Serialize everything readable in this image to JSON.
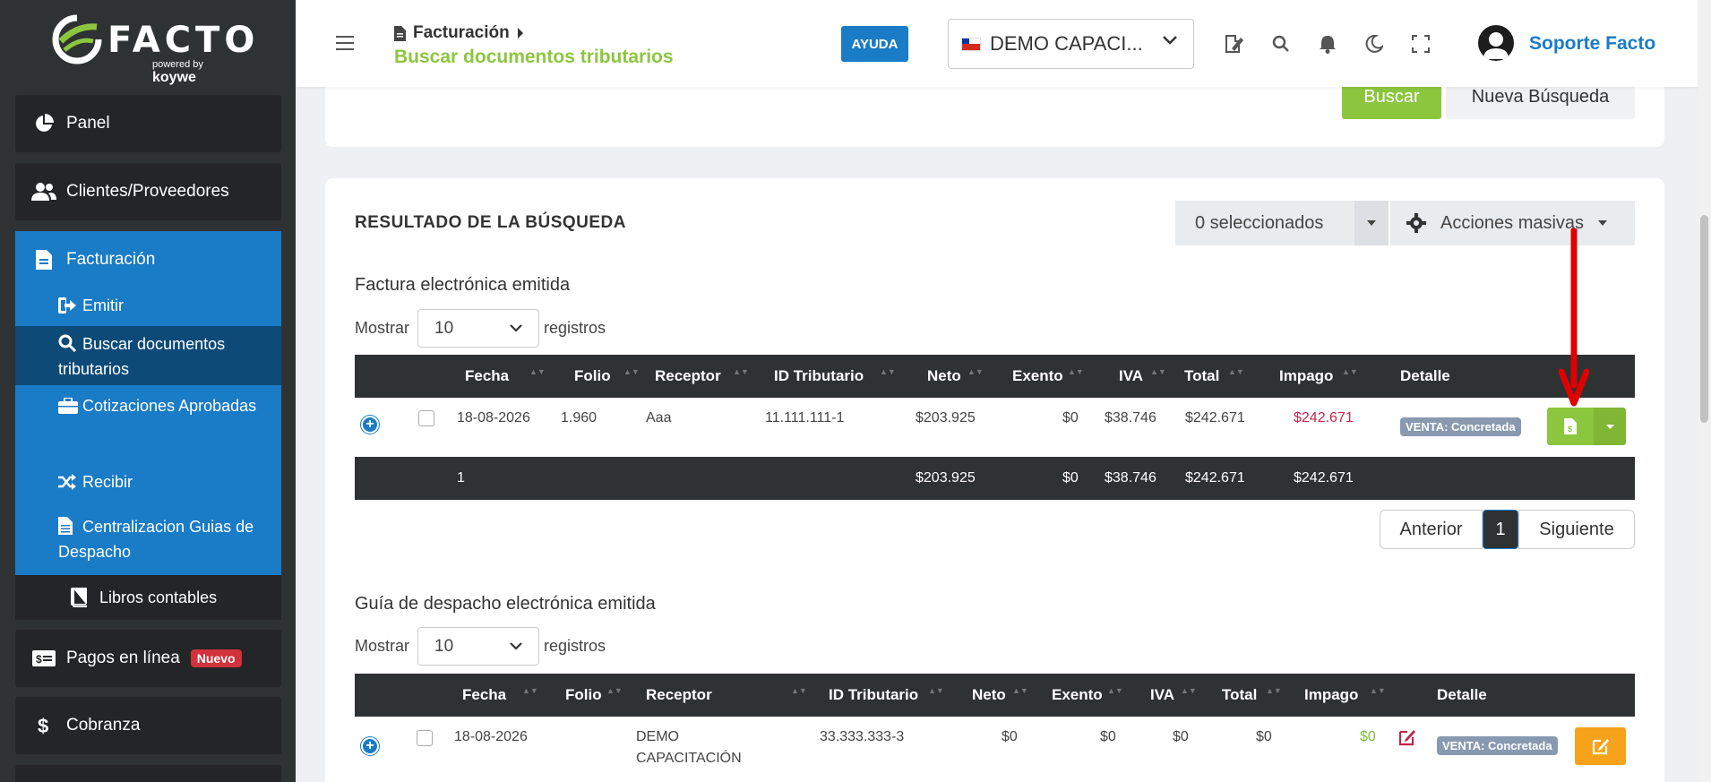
{
  "sidebar": {
    "logo_text": "FACTO",
    "logo_powered": "powered by",
    "logo_brand": "koywe",
    "items": {
      "panel": "Panel",
      "clientes": "Clientes/Proveedores",
      "facturacion": "Facturación",
      "emitir": "Emitir",
      "buscar": "Buscar documentos tributarios",
      "cotizaciones": "Cotizaciones Aprobadas",
      "recibir": "Recibir",
      "centralizacion": "Centralizacion Guias de Despacho",
      "libros": "Libros contables",
      "pagos": "Pagos en línea",
      "pagos_badge": "Nuevo",
      "cobranza": "Cobranza"
    }
  },
  "header": {
    "breadcrumb": "Facturación",
    "subtitle": "Buscar documentos tributarios",
    "help_label": "AYUDA",
    "company": "DEMO CAPACI...",
    "username": "Soporte Facto"
  },
  "search": {
    "buscar_label": "Buscar",
    "nueva_label": "Nueva Búsqueda"
  },
  "results": {
    "title": "RESULTADO DE LA BÚSQUEDA",
    "selected_label": "0 seleccionados",
    "mass_actions_label": "Acciones masivas",
    "mostrar_label": "Mostrar",
    "registros_label": "registros",
    "page_size": "10"
  },
  "facturas": {
    "section_title": "Factura electrónica emitida",
    "columns": [
      "Fecha",
      "Folio",
      "Receptor",
      "ID Tributario",
      "Neto",
      "Exento",
      "IVA",
      "Total",
      "Impago",
      "Detalle"
    ],
    "row": {
      "fecha": "18-08-2026",
      "folio": "1.960",
      "receptor": "Aaa",
      "id_tributario": "11.111.111-1",
      "neto": "$203.925",
      "exento": "$0",
      "iva": "$38.746",
      "total": "$242.671",
      "impago": "$242.671",
      "detalle": "VENTA: Concretada"
    },
    "totals": {
      "count": "1",
      "neto": "$203.925",
      "exento": "$0",
      "iva": "$38.746",
      "total": "$242.671",
      "impago": "$242.671"
    },
    "pager": {
      "prev": "Anterior",
      "current": "1",
      "next": "Siguiente"
    }
  },
  "guias": {
    "section_title": "Guía de despacho electrónica emitida",
    "columns": [
      "Fecha",
      "Folio",
      "Receptor",
      "ID Tributario",
      "Neto",
      "Exento",
      "IVA",
      "Total",
      "Impago",
      "Detalle"
    ],
    "row": {
      "fecha": "18-08-2026",
      "folio": "",
      "receptor_line1": "DEMO",
      "receptor_line2": "CAPACITACIÓN",
      "id_tributario": "33.333.333-3",
      "neto": "$0",
      "exento": "$0",
      "iva": "$0",
      "total": "$0",
      "impago": "$0",
      "detalle": "VENTA: Concretada"
    }
  },
  "colors": {
    "sidebar_bg": "#2f3233",
    "sidebar_active": "#1a7bc7",
    "sidebar_selected": "#0d4a78",
    "accent_green": "#8cc63f",
    "link_blue": "#1a7bc7",
    "impago_red": "#c0264b",
    "impago_green": "#7cbf3a",
    "edit_orange": "#f7a21b",
    "arrow_red": "#e00000"
  }
}
